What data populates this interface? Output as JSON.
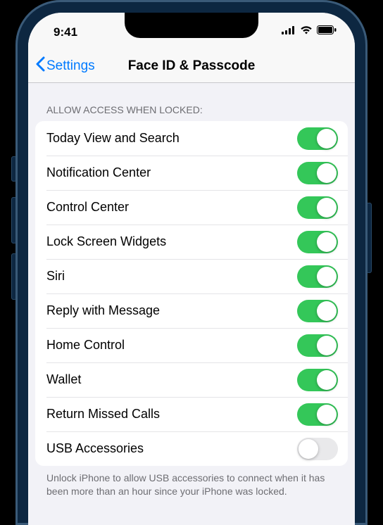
{
  "status": {
    "time": "9:41"
  },
  "nav": {
    "back": "Settings",
    "title": "Face ID & Passcode"
  },
  "section": {
    "header": "ALLOW ACCESS WHEN LOCKED:",
    "footer": "Unlock iPhone to allow USB accessories to connect when it has been more than an hour since your iPhone was locked."
  },
  "toggles": [
    {
      "label": "Today View and Search",
      "on": true
    },
    {
      "label": "Notification Center",
      "on": true
    },
    {
      "label": "Control Center",
      "on": true
    },
    {
      "label": "Lock Screen Widgets",
      "on": true
    },
    {
      "label": "Siri",
      "on": true
    },
    {
      "label": "Reply with Message",
      "on": true
    },
    {
      "label": "Home Control",
      "on": true
    },
    {
      "label": "Wallet",
      "on": true
    },
    {
      "label": "Return Missed Calls",
      "on": true
    },
    {
      "label": "USB Accessories",
      "on": false
    }
  ]
}
